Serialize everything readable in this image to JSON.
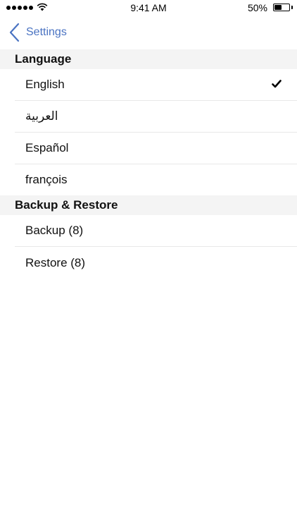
{
  "status_bar": {
    "time": "9:41 AM",
    "battery_percent": "50%",
    "battery_level": 0.5,
    "signal_icon": "signal-dots-icon",
    "wifi_icon": "wifi-icon",
    "battery_icon": "battery-icon"
  },
  "nav": {
    "back_label": "Settings",
    "back_icon": "chevron-left-icon",
    "accent_color": "#4a73c2"
  },
  "sections": [
    {
      "header": "Language",
      "items": [
        {
          "label": "English",
          "selected": true
        },
        {
          "label": "العربية",
          "selected": false
        },
        {
          "label": "Español",
          "selected": false
        },
        {
          "label": "françois",
          "selected": false
        }
      ]
    },
    {
      "header": "Backup & Restore",
      "items": [
        {
          "label": "Backup (8)"
        },
        {
          "label": "Restore (8)"
        }
      ]
    }
  ],
  "check_icon": "checkmark-icon"
}
